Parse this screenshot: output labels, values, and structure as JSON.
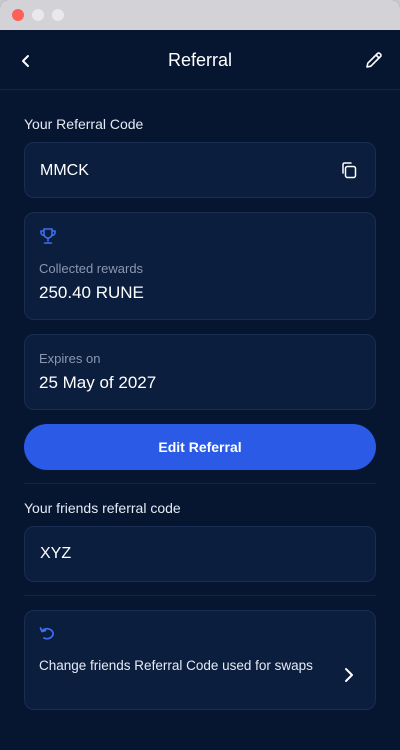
{
  "header": {
    "title": "Referral"
  },
  "referral": {
    "section_label": "Your Referral Code",
    "code": "MMCK",
    "rewards_label": "Collected rewards",
    "rewards_value": "250.40 RUNE",
    "expires_label": "Expires on",
    "expires_value": "25 May of 2027",
    "edit_button_label": "Edit Referral"
  },
  "friends": {
    "section_label": "Your friends referral code",
    "code": "XYZ",
    "change_action_label": "Change friends Referral Code used for swaps"
  },
  "colors": {
    "background": "#061530",
    "card": "#0b1e3d",
    "accent": "#2a5ae6",
    "icon_accent": "#3f6ff0"
  },
  "icons": [
    "back-icon",
    "pencil-icon",
    "copy-icon",
    "trophy-icon",
    "undo-icon",
    "chevron-right-icon"
  ]
}
